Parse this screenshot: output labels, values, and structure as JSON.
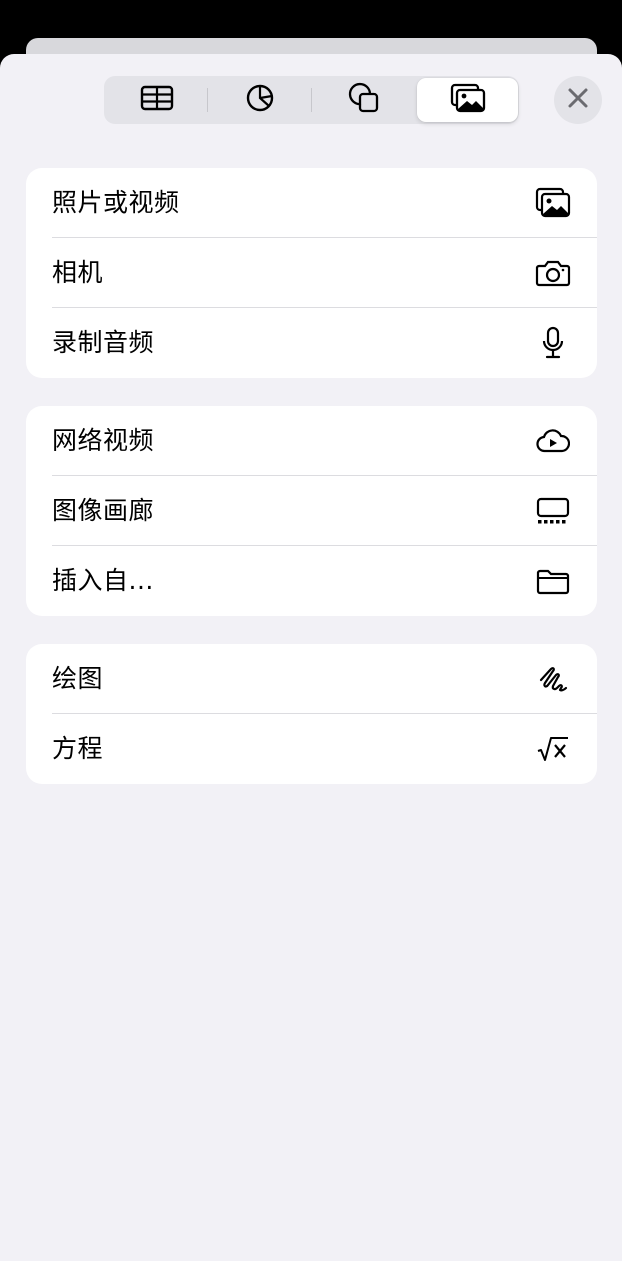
{
  "toolbar": {
    "tabs": [
      {
        "icon": "table-icon",
        "selected": false
      },
      {
        "icon": "chart-icon",
        "selected": false
      },
      {
        "icon": "shapes-icon",
        "selected": false
      },
      {
        "icon": "media-icon",
        "selected": true
      }
    ],
    "close_icon": "close-icon"
  },
  "groups": [
    {
      "items": [
        {
          "label": "照片或视频",
          "icon": "photo-icon"
        },
        {
          "label": "相机",
          "icon": "camera-icon"
        },
        {
          "label": "录制音频",
          "icon": "microphone-icon"
        }
      ]
    },
    {
      "items": [
        {
          "label": "网络视频",
          "icon": "cloud-play-icon"
        },
        {
          "label": "图像画廊",
          "icon": "image-gallery-icon"
        },
        {
          "label": "插入自...",
          "icon": "folder-icon"
        }
      ]
    },
    {
      "items": [
        {
          "label": "绘图",
          "icon": "drawing-icon"
        },
        {
          "label": "方程",
          "icon": "equation-icon"
        }
      ]
    }
  ]
}
